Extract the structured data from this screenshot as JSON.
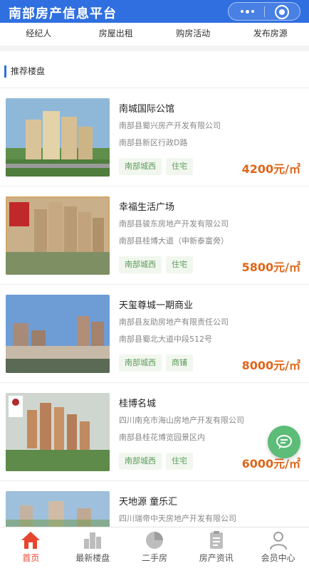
{
  "header": {
    "title": "南部房产信息平台"
  },
  "nav": {
    "items": [
      "经纪人",
      "房屋出租",
      "购房活动",
      "发布房源"
    ]
  },
  "section": {
    "title": "推荐楼盘"
  },
  "listings": [
    {
      "name": "南城国际公馆",
      "developer": "南部县蜀兴房产开发有限公司",
      "address": "南部县新区行政D路",
      "tags": [
        "南部城西",
        "住宅"
      ],
      "price": "4200元/㎡"
    },
    {
      "name": "幸福生活广场",
      "developer": "南部县骏东房地产开发有限公司",
      "address": "南部县桂博大道（申新泰富旁）",
      "tags": [
        "南部城西",
        "住宅"
      ],
      "price": "5800元/㎡"
    },
    {
      "name": "天玺尊城一期商业",
      "developer": "南部县友助房地产有限责任公司",
      "address": "南部县蜀北大道中段512号",
      "tags": [
        "南部城西",
        "商铺"
      ],
      "price": "8000元/㎡"
    },
    {
      "name": "桂博名城",
      "developer": "四川南充市海山房地产开发有限公司",
      "address": "南部县桂花博览园景区内",
      "tags": [
        "南部城西",
        "住宅"
      ],
      "price": "6000元/㎡"
    },
    {
      "name": "天地源 童乐汇",
      "developer": "四川瑞帝中天房地产开发有限公司",
      "address": "",
      "tags": [],
      "price": ""
    }
  ],
  "tabbar": {
    "items": [
      "首页",
      "最新楼盘",
      "二手房",
      "房产资讯",
      "会员中心"
    ]
  },
  "colors": {
    "brand": "#2f6fe0",
    "price": "#e0661a",
    "tag_text": "#5a9a5a",
    "active_tab": "#e8452f",
    "fab": "#5cbc78"
  },
  "icons": {
    "header_more": "more-dots-icon",
    "header_close": "target-close-icon",
    "fab": "chat-icon",
    "tabs": [
      "home-icon",
      "building-icon",
      "pie-chart-icon",
      "clipboard-icon",
      "user-icon"
    ]
  }
}
